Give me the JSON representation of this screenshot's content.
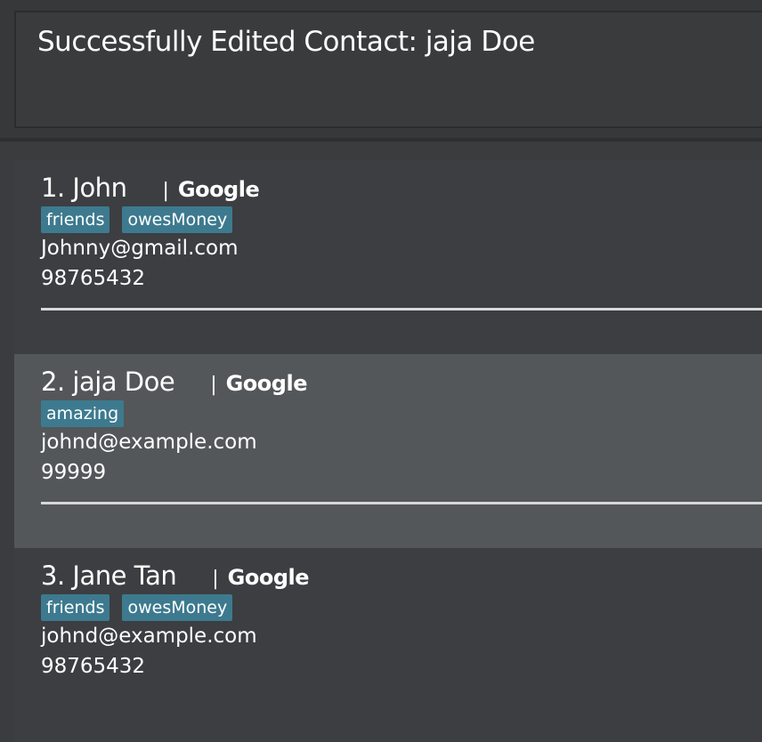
{
  "result": {
    "message": "Successfully Edited Contact: jaja Doe"
  },
  "contacts": [
    {
      "name": "1. John",
      "separator": "|",
      "company": "Google",
      "tags": [
        "friends",
        "owesMoney"
      ],
      "email": "Johnny@gmail.com",
      "phone": "98765432"
    },
    {
      "name": "2. jaja Doe",
      "separator": "|",
      "company": "Google",
      "tags": [
        "amazing"
      ],
      "email": "johnd@example.com",
      "phone": "99999"
    },
    {
      "name": "3. Jane Tan",
      "separator": "|",
      "company": "Google",
      "tags": [
        "friends",
        "owesMoney"
      ],
      "email": "johnd@example.com",
      "phone": "98765432"
    }
  ],
  "colors": {
    "background": "#3b3c3e",
    "selected_card": "#535759",
    "tag": "#3d7a8f",
    "text": "#ffffff"
  }
}
